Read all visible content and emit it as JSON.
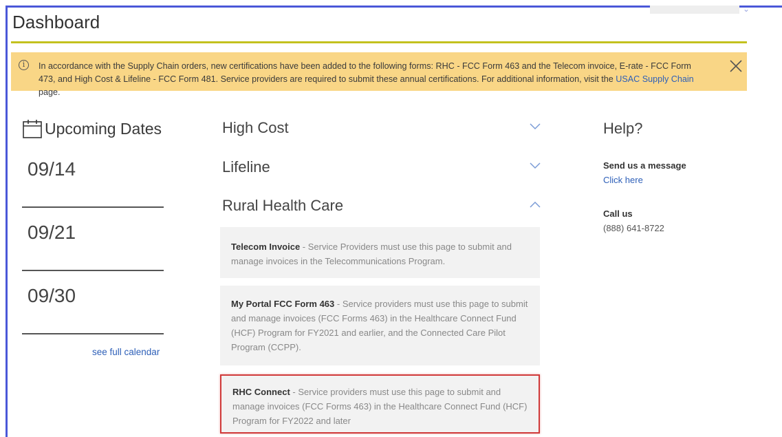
{
  "page": {
    "title": "Dashboard"
  },
  "alert": {
    "text_before": "In accordance with the Supply Chain orders, new certifications have been added to the following forms: RHC - FCC Form 463 and the Telecom invoice, E-rate - FCC Form 473, and High Cost & Lifeline - FCC Form 481. Service providers are required to submit these annual certifications. For additional information, visit the ",
    "link_text": "USAC Supply Chain",
    "text_after": " page.",
    "info_glyph": "i",
    "background": "#f9d686"
  },
  "upcoming": {
    "title": "Upcoming Dates",
    "dates": [
      "09/14",
      "09/21",
      "09/30"
    ],
    "see_full_calendar": "see full calendar"
  },
  "programs": {
    "high_cost": {
      "label": "High Cost",
      "expanded": false
    },
    "lifeline": {
      "label": "Lifeline",
      "expanded": false
    },
    "rural_health_care": {
      "label": "Rural Health Care",
      "expanded": true,
      "items": [
        {
          "name": "Telecom Invoice",
          "desc": " - Service Providers must use this page to submit and manage invoices in the Telecommunications Program."
        },
        {
          "name": "My Portal FCC Form 463",
          "desc": " - Service providers must use this page to submit and manage invoices (FCC Forms 463) in the Healthcare Connect Fund (HCF) Program for FY2021 and earlier, and the Connected Care Pilot Program (CCPP)."
        },
        {
          "name": "RHC Connect",
          "desc": " - Service providers must use this page to submit and manage invoices (FCC Forms 463) in the Healthcare Connect Fund (HCF) Program for FY2022 and later"
        }
      ]
    }
  },
  "help": {
    "title": "Help?",
    "message_label": "Send us a message",
    "message_link": "Click here",
    "call_label": "Call us",
    "phone": "(888) 641-8722"
  },
  "colors": {
    "accent_rule": "#c3c11e",
    "link": "#2d5fb8",
    "highlight_border": "#d03a3a",
    "frame": "#4a58d8"
  }
}
